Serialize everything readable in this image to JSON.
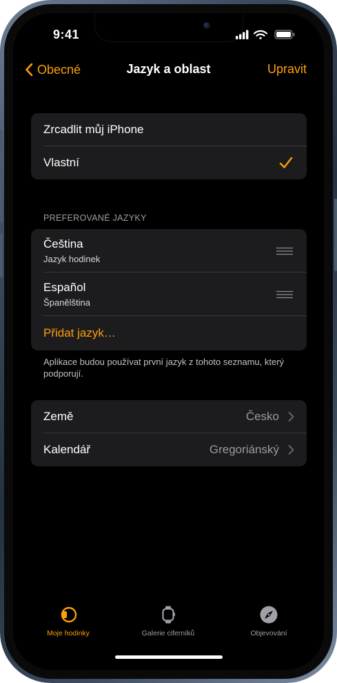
{
  "status_bar": {
    "time": "9:41"
  },
  "nav": {
    "back_label": "Obecné",
    "title": "Jazyk a oblast",
    "action_label": "Upravit"
  },
  "mode_group": {
    "items": [
      {
        "label": "Zrcadlit můj iPhone",
        "checked": false
      },
      {
        "label": "Vlastní",
        "checked": true
      }
    ]
  },
  "languages": {
    "header": "PREFEROVANÉ JAZYKY",
    "items": [
      {
        "label": "Čeština",
        "sublabel": "Jazyk hodinek"
      },
      {
        "label": "Español",
        "sublabel": "Španělština"
      }
    ],
    "add_label": "Přidat jazyk…",
    "footer": "Aplikace budou používat první jazyk z tohoto seznamu, který podporují."
  },
  "region_group": {
    "items": [
      {
        "label": "Země",
        "value": "Česko"
      },
      {
        "label": "Kalendář",
        "value": "Gregoriánský"
      }
    ]
  },
  "tab_bar": {
    "tabs": [
      {
        "label": "Moje hodinky",
        "icon": "watch-icon",
        "active": true
      },
      {
        "label": "Galerie ciferníků",
        "icon": "watch-face-icon",
        "active": false
      },
      {
        "label": "Objevování",
        "icon": "compass-icon",
        "active": false
      }
    ]
  },
  "colors": {
    "accent": "#ff9f0a",
    "background": "#000000",
    "group_background": "#1c1c1e",
    "separator": "#38383a",
    "secondary_text": "#9a9aa0"
  }
}
